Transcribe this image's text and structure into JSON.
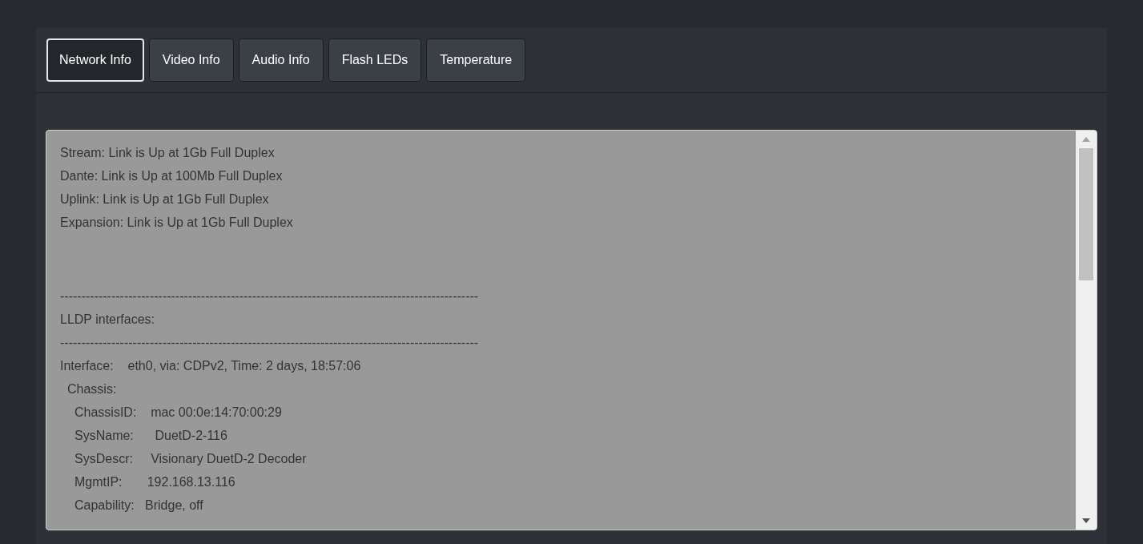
{
  "tabs": [
    {
      "label": "Network Info",
      "selected": true
    },
    {
      "label": "Video Info",
      "selected": false
    },
    {
      "label": "Audio Info",
      "selected": false
    },
    {
      "label": "Flash LEDs",
      "selected": false
    },
    {
      "label": "Temperature",
      "selected": false
    }
  ],
  "output": {
    "link_status": [
      "Stream: Link is Up at 1Gb Full Duplex",
      "Dante: Link is Up at 100Mb Full Duplex",
      "Uplink: Link is Up at 1Gb Full Duplex",
      "Expansion: Link is Up at 1Gb Full Duplex"
    ],
    "separator": "--------------------------------------------------------------------------------------------------",
    "section_title": "LLDP interfaces:",
    "separator_2": "--------------------------------------------------------------------------------------------------",
    "interfaces": [
      {
        "text": "Interface:    eth0, via: CDPv2, Time: 2 days, 18:57:06",
        "children": [
          {
            "text": "Chassis:",
            "children": [
              {
                "text": "ChassisID:    mac 00:0e:14:70:00:29"
              },
              {
                "text": "SysName:      DuetD-2-116"
              },
              {
                "text": "SysDescr:     Visionary DuetD-2 Decoder"
              },
              {
                "text": "MgmtIP:       192.168.13.116"
              },
              {
                "text": "Capability:   Bridge, off"
              }
            ]
          }
        ]
      }
    ]
  }
}
